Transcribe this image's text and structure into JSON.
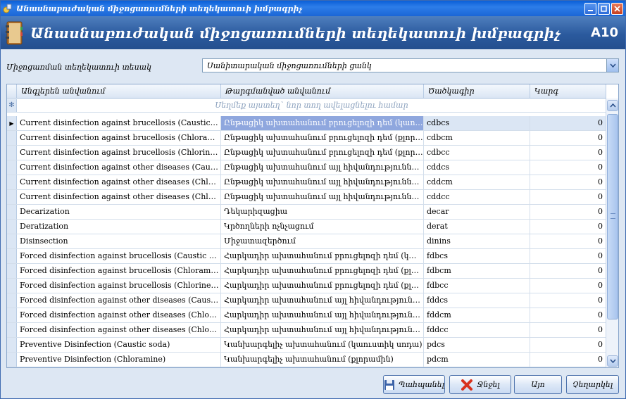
{
  "window": {
    "title": "Անասնաբուժական միջոցառումների տեղեկատուի խմբագրիչ",
    "buttons": [
      "minimize",
      "maximize",
      "close"
    ]
  },
  "banner": {
    "heading": "Անասնաբուժական միջոցառումների տեղեկատուի խմբագրիչ",
    "code": "A10"
  },
  "type": {
    "label": "Միջոցառման տեղեկատուի տեսակ",
    "value": "Սանիտարական միջոցառումների ցանկ"
  },
  "grid": {
    "columns": [
      "Անգլերեն անվանում",
      "Թարգմանված անվանում",
      "Ծածկագիր",
      "Կարգ"
    ],
    "new_row_hint": "Սեղմեք այստեղ` նոր տող ավելացնելու համար",
    "new_row_marker": "✻",
    "selected_row": 0,
    "rows": [
      {
        "en": "Current disinfection against brucellosis (Caustic soda)",
        "tr": "Ընթացիկ ախտահանում բրուցելոզի դեմ (կաուստիկ սոդա)",
        "code": "cdbcs",
        "order": "0"
      },
      {
        "en": "Current disinfection against brucellosis (Chloramine)",
        "tr": "Ընթացիկ ախտահանում բրուցելոզի դեմ (քլորամին)",
        "code": "cdbcm",
        "order": "0"
      },
      {
        "en": "Current disinfection against brucellosis (Chlorine compound)",
        "tr": "Ընթացիկ ախտահանում բրուցելոզի դեմ (քլոր պարունակող)",
        "code": "cdbcc",
        "order": "0"
      },
      {
        "en": "Current disinfection against other diseases (Caustic soda)",
        "tr": "Ընթացիկ ախտահանում այլ հիվանդությունների դեմ (կաուստիկ սոդա)",
        "code": "cddcs",
        "order": "0"
      },
      {
        "en": "Current disinfection against other diseases (Chloramine)",
        "tr": "Ընթացիկ ախտահանում այլ հիվանդությունների դեմ (քլորամին)",
        "code": "cddcm",
        "order": "0"
      },
      {
        "en": "Current disinfection against other diseases (Chlorine compound)",
        "tr": "Ընթացիկ ախտահանում այլ հիվանդությունների դեմ (քլոր պարունակող)",
        "code": "cddcc",
        "order": "0"
      },
      {
        "en": "Decarization",
        "tr": "Դեկարիզացիա",
        "code": "decar",
        "order": "0"
      },
      {
        "en": "Deratization",
        "tr": "Կրծողների ոչնչացում",
        "code": "derat",
        "order": "0"
      },
      {
        "en": "Disinsection",
        "tr": "Միջատազերծում",
        "code": "dinins",
        "order": "0"
      },
      {
        "en": "Forced disinfection against brucellosis (Caustic soda)",
        "tr": "Հարկադիր ախտահանում բրուցելոզի դեմ (կաուստիկ սոդա)",
        "code": "fdbcs",
        "order": "0"
      },
      {
        "en": "Forced disinfection against brucellosis (Chloramine)",
        "tr": "Հարկադիր ախտահանում բրուցելոզի դեմ (քլորամին)",
        "code": "fdbcm",
        "order": "0"
      },
      {
        "en": "Forced disinfection against brucellosis (Chlorine compound)",
        "tr": "Հարկադիր ախտահանում բրուցելոզի դեմ (քլոր պարունակող)",
        "code": "fdbcc",
        "order": "0"
      },
      {
        "en": "Forced disinfection against other diseases (Caustic soda)",
        "tr": "Հարկադիր ախտահանում այլ հիվանդությունների դեմ (կաուստիկ սոդա)",
        "code": "fddcs",
        "order": "0"
      },
      {
        "en": "Forced disinfection against other diseases (Chloramine)",
        "tr": "Հարկադիր ախտահանում այլ հիվանդությունների դեմ (քլորամին)",
        "code": "fddcm",
        "order": "0"
      },
      {
        "en": "Forced disinfection against other diseases (Chlorine compound)",
        "tr": "Հարկադիր ախտահանում այլ հիվանդությունների դեմ (քլոր պարունակող)",
        "code": "fddcc",
        "order": "0"
      },
      {
        "en": "Preventive Disinfection (Caustic soda)",
        "tr": "Կանխարգելիչ ախտահանում (կաուստիկ սոդա)",
        "code": "pdcs",
        "order": "0"
      },
      {
        "en": "Preventive Disinfection (Chloramine)",
        "tr": "Կանխարգելիչ ախտահանում (քլորամին)",
        "code": "pdcm",
        "order": "0"
      }
    ]
  },
  "buttons": {
    "save": "Պահպանել",
    "delete": "Ջնջել",
    "ok": "Այո",
    "cancel": "Չեղարկել"
  },
  "colors": {
    "titlebar": "#1b66d6",
    "banner": "#2b5a9e",
    "selection": "#8fa7de"
  }
}
